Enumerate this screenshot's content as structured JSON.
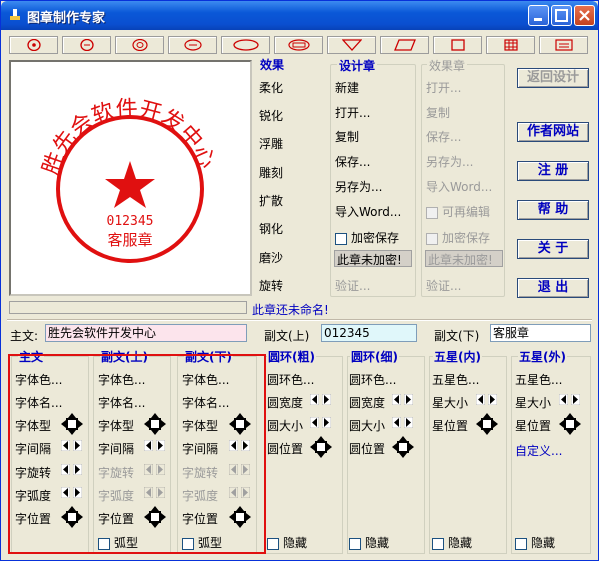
{
  "title": "图章制作专家",
  "toolbar": [
    "circle-star",
    "circle-ring",
    "circle-double",
    "oval-ring",
    "oval",
    "oval-double",
    "triangle-down",
    "parallelogram",
    "square",
    "grid",
    "rect-line"
  ],
  "preview": {
    "stamp_text": "胜先会软件开发中心",
    "stamp_num": "012345",
    "stamp_sub": "客服章"
  },
  "status_unnamed": "此章还未命名!",
  "effects": {
    "title": "效果",
    "items": [
      "柔化",
      "锐化",
      "浮雕",
      "雕刻",
      "扩散",
      "钢化",
      "磨沙",
      "旋转"
    ]
  },
  "design": {
    "title": "设计章",
    "items": [
      "新建",
      "打开...",
      "复制",
      "保存...",
      "另存为...",
      "导入Word..."
    ],
    "encrypt": "加密保存",
    "encrypt_status": "此章未加密!",
    "verify": "验证..."
  },
  "effect_stamp": {
    "title": "效果章",
    "items": [
      "打开...",
      "复制",
      "保存...",
      "另存为...",
      "导入Word..."
    ],
    "reedit": "可再编辑",
    "encrypt": "加密保存",
    "encrypt_status": "此章未加密!",
    "verify": "验证..."
  },
  "right_buttons": [
    "返回设计",
    "作者网站",
    "注 册",
    "帮 助",
    "关 于",
    "退 出"
  ],
  "main_text": {
    "label": "主文:",
    "value": "胜先会软件开发中心"
  },
  "sub_top": {
    "label": "副文(上)",
    "value": "012345"
  },
  "sub_bottom": {
    "label": "副文(下)",
    "value": "客服章"
  },
  "panels": {
    "main": {
      "title": "主文",
      "items": [
        "字体色...",
        "字体名...",
        "字体型",
        "字间隔",
        "字旋转",
        "字弧度",
        "字位置"
      ]
    },
    "subtop": {
      "title": "副文(上)",
      "items": [
        "字体色...",
        "字体名...",
        "字体型",
        "字间隔",
        "字旋转",
        "字弧度",
        "字位置"
      ],
      "arc": "弧型"
    },
    "subbot": {
      "title": "副文(下)",
      "items": [
        "字体色...",
        "字体名...",
        "字体型",
        "字间隔",
        "字旋转",
        "字弧度",
        "字位置"
      ],
      "arc": "弧型"
    },
    "ring_thick": {
      "title": "圆环(粗)",
      "items": [
        "圆环色...",
        "圆宽度",
        "圆大小",
        "圆位置"
      ],
      "hide": "隐藏"
    },
    "ring_thin": {
      "title": "圆环(细)",
      "items": [
        "圆环色...",
        "圆宽度",
        "圆大小",
        "圆位置"
      ],
      "hide": "隐藏"
    },
    "star_in": {
      "title": "五星(内)",
      "items": [
        "五星色...",
        "星大小",
        "星位置"
      ],
      "hide": "隐藏"
    },
    "star_out": {
      "title": "五星(外)",
      "items": [
        "五星色...",
        "星大小",
        "星位置",
        "自定义..."
      ],
      "hide": "隐藏"
    }
  },
  "colors": {
    "title_bar": "#0a58d8",
    "accent": "#0000c0",
    "stamp": "#e01010"
  }
}
